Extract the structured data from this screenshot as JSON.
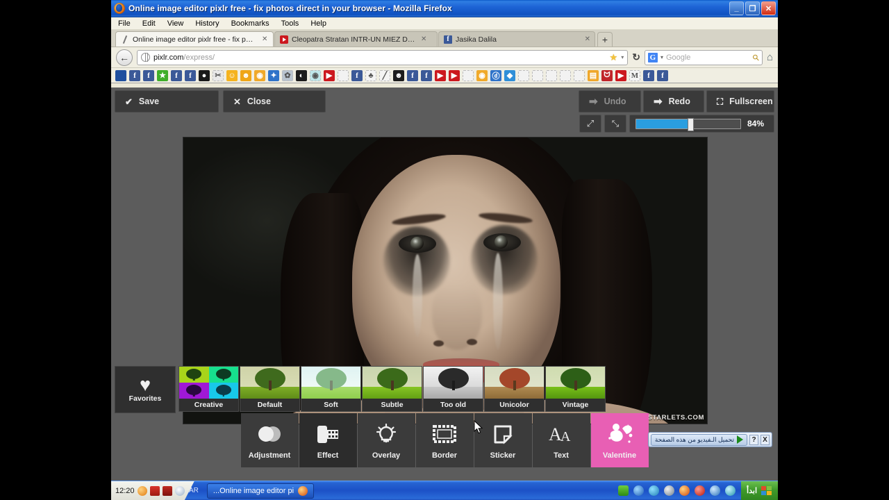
{
  "window": {
    "title": "Online image editor pixlr free - fix photos direct in your browser - Mozilla Firefox",
    "app_icon": "firefox-icon",
    "controls": {
      "minimize": "_",
      "maximize": "❐",
      "close": "✕"
    }
  },
  "menubar": {
    "items": [
      "File",
      "Edit",
      "View",
      "History",
      "Bookmarks",
      "Tools",
      "Help"
    ]
  },
  "tabs": [
    {
      "label": "Online image editor pixlr free - fix photos...",
      "favicon": "pixlr-icon",
      "active": true,
      "close": "✕"
    },
    {
      "label": "Cleopatra Stratan INTR-UN MIEZ DE NO...",
      "favicon": "youtube-icon",
      "active": false,
      "close": "✕"
    },
    {
      "label": "Jasika Dalila",
      "favicon": "facebook-icon",
      "active": false,
      "close": "✕"
    }
  ],
  "newtab_label": "+",
  "navbar": {
    "back_icon": "back-arrow-icon",
    "site_icon": "globe-icon",
    "url_domain": "pixlr.com",
    "url_path": "/express/",
    "bookmark_star": "★",
    "dropdown_marker": "▾",
    "reload_icon": "↻",
    "search_engine": "G",
    "search_engine_name": "Google",
    "search_placeholder": "Google",
    "search_value": "",
    "magnifier_icon": "search-icon",
    "home_icon": "home-icon"
  },
  "bookmarks": [
    {
      "name": "bookmark-blue-swoosh",
      "color": "#1f4f9e",
      "glyph": ""
    },
    {
      "name": "bookmark-facebook-1",
      "color": "#3b5998",
      "glyph": "f"
    },
    {
      "name": "bookmark-facebook-2",
      "color": "#3b5998",
      "glyph": "f"
    },
    {
      "name": "bookmark-green-star",
      "color": "#3fae29",
      "glyph": "★"
    },
    {
      "name": "bookmark-facebook-3",
      "color": "#3b5998",
      "glyph": "f"
    },
    {
      "name": "bookmark-facebook-4",
      "color": "#3b5998",
      "glyph": "f"
    },
    {
      "name": "bookmark-red-dark",
      "color": "#1a1a1a",
      "glyph": "●"
    },
    {
      "name": "bookmark-film",
      "color": "#e9e9e9",
      "glyph": "✂"
    },
    {
      "name": "bookmark-smiley-orange",
      "color": "#f5b31f",
      "glyph": "☺"
    },
    {
      "name": "bookmark-smiley-laugh",
      "color": "#efa617",
      "glyph": "☻"
    },
    {
      "name": "bookmark-photo-orange",
      "color": "#f0a92a",
      "glyph": "◉"
    },
    {
      "name": "bookmark-blue-puzzle",
      "color": "#2f73c9",
      "glyph": "✦"
    },
    {
      "name": "bookmark-grey-misc",
      "color": "#b9c4cf",
      "glyph": "✿"
    },
    {
      "name": "bookmark-globe-dark",
      "color": "#1c1c1c",
      "glyph": "◐"
    },
    {
      "name": "bookmark-search-teal",
      "color": "#bfe7ea",
      "glyph": "◉"
    },
    {
      "name": "bookmark-youtube-1",
      "color": "#cc181e",
      "glyph": "▶"
    },
    {
      "name": "bookmark-placeholder-1",
      "color": "#f2f2f2",
      "glyph": ""
    },
    {
      "name": "bookmark-facebook-5",
      "color": "#3b5998",
      "glyph": "f"
    },
    {
      "name": "bookmark-bird-dark",
      "color": "#f4f4f4",
      "glyph": "♣"
    },
    {
      "name": "bookmark-pencil",
      "color": "#f4f4f4",
      "glyph": "╱"
    },
    {
      "name": "bookmark-face-dark",
      "color": "#1c1c1c",
      "glyph": "☻"
    },
    {
      "name": "bookmark-facebook-6",
      "color": "#3b5998",
      "glyph": "f"
    },
    {
      "name": "bookmark-facebook-7",
      "color": "#3b5998",
      "glyph": "f"
    },
    {
      "name": "bookmark-youtube-2",
      "color": "#cc181e",
      "glyph": "▶"
    },
    {
      "name": "bookmark-youtube-3",
      "color": "#cc181e",
      "glyph": "▶"
    },
    {
      "name": "bookmark-placeholder-2",
      "color": "#f2f2f2",
      "glyph": ""
    },
    {
      "name": "bookmark-photo-orange-2",
      "color": "#f0a92a",
      "glyph": "◉"
    },
    {
      "name": "bookmark-blue-dp",
      "color": "#2f73c9",
      "glyph": "ⓓ"
    },
    {
      "name": "bookmark-drop-blue",
      "color": "#2f8fd8",
      "glyph": "◆"
    },
    {
      "name": "bookmark-placeholder-3",
      "color": "#f2f2f2",
      "glyph": ""
    },
    {
      "name": "bookmark-placeholder-4",
      "color": "#f2f2f2",
      "glyph": ""
    },
    {
      "name": "bookmark-placeholder-5",
      "color": "#f2f2f2",
      "glyph": ""
    },
    {
      "name": "bookmark-placeholder-6",
      "color": "#f2f2f2",
      "glyph": ""
    },
    {
      "name": "bookmark-placeholder-7",
      "color": "#f2f2f2",
      "glyph": ""
    },
    {
      "name": "bookmark-rss-orange",
      "color": "#efa72b",
      "glyph": "▤"
    },
    {
      "name": "bookmark-cat-red",
      "color": "#c0252a",
      "glyph": "ᗢ"
    },
    {
      "name": "bookmark-youtube-4",
      "color": "#cc181e",
      "glyph": "▶"
    },
    {
      "name": "bookmark-gmail",
      "color": "#f4f4f4",
      "glyph": "M"
    },
    {
      "name": "bookmark-facebook-8",
      "color": "#3b5998",
      "glyph": "f"
    },
    {
      "name": "bookmark-facebook-9",
      "color": "#3b5998",
      "glyph": "f"
    }
  ],
  "pixlr": {
    "save_label": "Save",
    "save_icon": "check-icon",
    "close_label": "Close",
    "close_icon": "x-icon",
    "undo_label": "Undo",
    "undo_icon": "arrow-left-icon",
    "redo_label": "Redo",
    "redo_icon": "arrow-right-icon",
    "fullscreen_label": "Fullscreen",
    "fullscreen_icon": "expand-icon",
    "zoom_out_icon": "zoom-fit-icon",
    "zoom_in_icon": "zoom-actual-icon",
    "zoom_value": "84%",
    "zoom_percent": 52,
    "accent_color": "#2a9ee0",
    "photo": {
      "alt": "Girl with running mascara tears",
      "watermark": "CHILDSTARLETS.COM"
    },
    "favorites": {
      "label": "Favorites",
      "icon": "heart-icon"
    },
    "filters": [
      {
        "label": "Creative",
        "style": "creative"
      },
      {
        "label": "Default",
        "style": "default"
      },
      {
        "label": "Soft",
        "style": "soft"
      },
      {
        "label": "Subtle",
        "style": "subtle"
      },
      {
        "label": "Too old",
        "style": "tooold"
      },
      {
        "label": "Unicolor",
        "style": "unicolor"
      },
      {
        "label": "Vintage",
        "style": "vintage"
      }
    ],
    "categories": [
      {
        "label": "Adjustment",
        "icon": "contrast-circles-icon",
        "state": "normal"
      },
      {
        "label": "Effect",
        "icon": "film-roll-icon",
        "state": "active"
      },
      {
        "label": "Overlay",
        "icon": "lightbulb-icon",
        "state": "normal"
      },
      {
        "label": "Border",
        "icon": "frame-icon",
        "state": "normal"
      },
      {
        "label": "Sticker",
        "icon": "sticker-icon",
        "state": "normal"
      },
      {
        "label": "Text",
        "icon": "text-aa-icon",
        "state": "normal"
      },
      {
        "label": "Valentine",
        "icon": "cupid-icon",
        "state": "highlight",
        "color": "#e85fb4"
      }
    ]
  },
  "download_bar": {
    "button_text": "تحميل الـفيديو من هذه الصفحة",
    "play_icon": "play-icon",
    "help_label": "?",
    "close_label": "X"
  },
  "taskbar": {
    "clock": "12:20",
    "tray_left_icons": [
      "orange-circle-icon",
      "red-x-signal-icon",
      "red-key-icon",
      "grey-arrow-icon"
    ],
    "language": "AR",
    "task_button": {
      "label": "...Online image editor pi",
      "icon": "firefox-icon"
    },
    "sys_icons": [
      "green-plug-icon",
      "msn-icon",
      "blue-circle-icon",
      "media-player-icon",
      "firefox-icon",
      "red-power-icon",
      "ie-icon",
      "teal-refresh-icon"
    ],
    "lang_bar": {
      "label": "ابدأ",
      "icon": "windows-flag-icon"
    }
  }
}
